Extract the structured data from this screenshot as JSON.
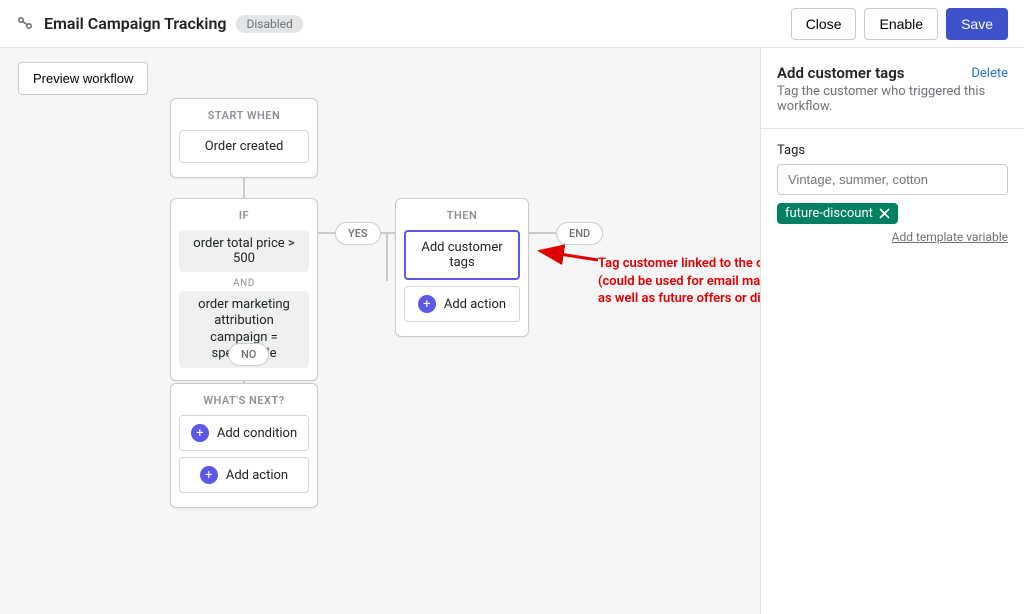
{
  "header": {
    "title": "Email Campaign Tracking",
    "status": "Disabled",
    "close_label": "Close",
    "enable_label": "Enable",
    "save_label": "Save"
  },
  "toolbar": {
    "preview_label": "Preview workflow"
  },
  "nodes": {
    "start": {
      "title": "START WHEN",
      "label": "Order created"
    },
    "if": {
      "title": "IF",
      "cond1": "order total price > 500",
      "and": "AND",
      "cond2": "order marketing attribution campaign = specialsale"
    },
    "then": {
      "title": "THEN",
      "action": "Add customer tags",
      "add_action": "Add action"
    },
    "next": {
      "title": "WHAT'S NEXT?",
      "add_condition": "Add condition",
      "add_action": "Add action"
    }
  },
  "pills": {
    "yes": "YES",
    "no": "NO",
    "end": "END"
  },
  "panel": {
    "title": "Add customer tags",
    "delete": "Delete",
    "desc": "Tag the customer who triggered this workflow.",
    "tags_label": "Tags",
    "tags_placeholder": "Vintage, summer, cotton",
    "tag_value": "future-discount",
    "add_var": "Add template variable"
  },
  "annotation": {
    "text": "Tag customer linked to the order\n(could be used for email marketing\nas well as future offers or discounts)"
  }
}
